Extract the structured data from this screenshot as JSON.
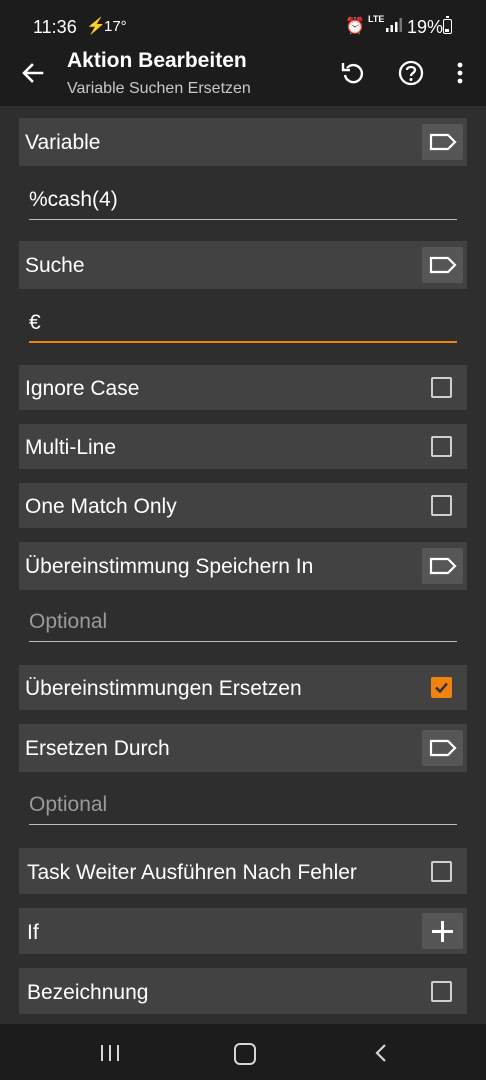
{
  "status": {
    "time": "11:36",
    "temperature": "17°",
    "network": "LTE",
    "battery": "19%"
  },
  "appbar": {
    "title": "Aktion Bearbeiten",
    "subtitle": "Variable Suchen Ersetzen"
  },
  "form": {
    "variable": {
      "label": "Variable",
      "value": "%cash(4)"
    },
    "search": {
      "label": "Suche",
      "value": "€"
    },
    "ignore_case": {
      "label": "Ignore Case",
      "checked": false
    },
    "multi_line": {
      "label": "Multi-Line",
      "checked": false
    },
    "one_match_only": {
      "label": "One Match Only",
      "checked": false
    },
    "store_matches": {
      "label": "Übereinstimmung Speichern In",
      "placeholder": "Optional"
    },
    "replace_matches": {
      "label": "Übereinstimmungen Ersetzen",
      "checked": true
    },
    "replace_with": {
      "label": "Ersetzen Durch",
      "placeholder": "Optional"
    },
    "continue_after_error": {
      "label": "Task Weiter Ausführen Nach Fehler",
      "checked": false
    },
    "if": {
      "label": "If"
    },
    "label_row": {
      "label": "Bezeichnung",
      "checked": false
    }
  },
  "colors": {
    "accent": "#f0820f",
    "row_bg": "#424242",
    "page_bg": "#2e2e2e",
    "bar_bg": "#1c1c1c"
  }
}
